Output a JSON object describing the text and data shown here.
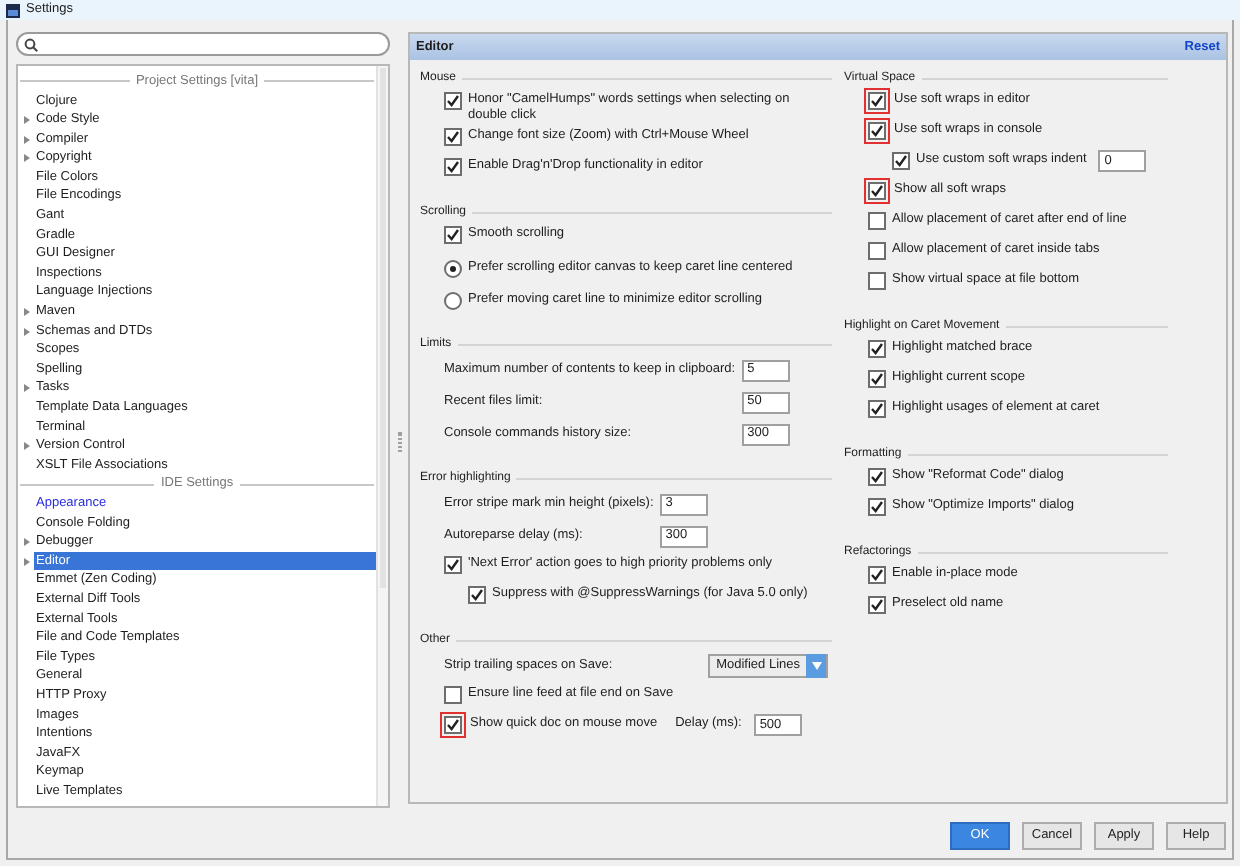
{
  "window": {
    "title": "Settings"
  },
  "tree": [
    {
      "kind": "header",
      "label": "Project Settings [vita]"
    },
    {
      "kind": "item",
      "label": "Clojure",
      "expandable": false,
      "selected": false,
      "modified": false
    },
    {
      "kind": "item",
      "label": "Code Style",
      "expandable": true,
      "selected": false,
      "modified": false
    },
    {
      "kind": "item",
      "label": "Compiler",
      "expandable": true,
      "selected": false,
      "modified": false
    },
    {
      "kind": "item",
      "label": "Copyright",
      "expandable": true,
      "selected": false,
      "modified": false
    },
    {
      "kind": "item",
      "label": "File Colors",
      "expandable": false,
      "selected": false,
      "modified": false
    },
    {
      "kind": "item",
      "label": "File Encodings",
      "expandable": false,
      "selected": false,
      "modified": false
    },
    {
      "kind": "item",
      "label": "Gant",
      "expandable": false,
      "selected": false,
      "modified": false
    },
    {
      "kind": "item",
      "label": "Gradle",
      "expandable": false,
      "selected": false,
      "modified": false
    },
    {
      "kind": "item",
      "label": "GUI Designer",
      "expandable": false,
      "selected": false,
      "modified": false
    },
    {
      "kind": "item",
      "label": "Inspections",
      "expandable": false,
      "selected": false,
      "modified": false
    },
    {
      "kind": "item",
      "label": "Language Injections",
      "expandable": false,
      "selected": false,
      "modified": false
    },
    {
      "kind": "item",
      "label": "Maven",
      "expandable": true,
      "selected": false,
      "modified": false
    },
    {
      "kind": "item",
      "label": "Schemas and DTDs",
      "expandable": true,
      "selected": false,
      "modified": false
    },
    {
      "kind": "item",
      "label": "Scopes",
      "expandable": false,
      "selected": false,
      "modified": false
    },
    {
      "kind": "item",
      "label": "Spelling",
      "expandable": false,
      "selected": false,
      "modified": false
    },
    {
      "kind": "item",
      "label": "Tasks",
      "expandable": true,
      "selected": false,
      "modified": false
    },
    {
      "kind": "item",
      "label": "Template Data Languages",
      "expandable": false,
      "selected": false,
      "modified": false
    },
    {
      "kind": "item",
      "label": "Terminal",
      "expandable": false,
      "selected": false,
      "modified": false
    },
    {
      "kind": "item",
      "label": "Version Control",
      "expandable": true,
      "selected": false,
      "modified": false
    },
    {
      "kind": "item",
      "label": "XSLT File Associations",
      "expandable": false,
      "selected": false,
      "modified": false
    },
    {
      "kind": "header",
      "label": "IDE Settings"
    },
    {
      "kind": "item",
      "label": "Appearance",
      "expandable": false,
      "selected": false,
      "modified": true
    },
    {
      "kind": "item",
      "label": "Console Folding",
      "expandable": false,
      "selected": false,
      "modified": false
    },
    {
      "kind": "item",
      "label": "Debugger",
      "expandable": true,
      "selected": false,
      "modified": false
    },
    {
      "kind": "item",
      "label": "Editor",
      "expandable": true,
      "selected": true,
      "modified": false
    },
    {
      "kind": "item",
      "label": "Emmet (Zen Coding)",
      "expandable": false,
      "selected": false,
      "modified": false
    },
    {
      "kind": "item",
      "label": "External Diff Tools",
      "expandable": false,
      "selected": false,
      "modified": false
    },
    {
      "kind": "item",
      "label": "External Tools",
      "expandable": false,
      "selected": false,
      "modified": false
    },
    {
      "kind": "item",
      "label": "File and Code Templates",
      "expandable": false,
      "selected": false,
      "modified": false
    },
    {
      "kind": "item",
      "label": "File Types",
      "expandable": false,
      "selected": false,
      "modified": false
    },
    {
      "kind": "item",
      "label": "General",
      "expandable": false,
      "selected": false,
      "modified": false
    },
    {
      "kind": "item",
      "label": "HTTP Proxy",
      "expandable": false,
      "selected": false,
      "modified": false
    },
    {
      "kind": "item",
      "label": "Images",
      "expandable": false,
      "selected": false,
      "modified": false
    },
    {
      "kind": "item",
      "label": "Intentions",
      "expandable": false,
      "selected": false,
      "modified": false
    },
    {
      "kind": "item",
      "label": "JavaFX",
      "expandable": false,
      "selected": false,
      "modified": false
    },
    {
      "kind": "item",
      "label": "Keymap",
      "expandable": false,
      "selected": false,
      "modified": false
    },
    {
      "kind": "item",
      "label": "Live Templates",
      "expandable": false,
      "selected": false,
      "modified": false
    }
  ],
  "panel": {
    "title": "Editor",
    "reset": "Reset"
  },
  "columns": [
    [
      {
        "title": "Mouse",
        "items": [
          {
            "kind": "checkbox",
            "label": "Honor \"CamelHumps\" words settings when selecting on double click",
            "checked": true,
            "highlighted": false
          },
          {
            "kind": "checkbox",
            "label": "Change font size (Zoom) with Ctrl+Mouse Wheel",
            "checked": true,
            "highlighted": false
          },
          {
            "kind": "checkbox",
            "label": "Enable Drag'n'Drop functionality in editor",
            "checked": true,
            "highlighted": false
          }
        ]
      },
      {
        "title": "Scrolling",
        "items": [
          {
            "kind": "checkbox",
            "label": "Smooth scrolling",
            "checked": true,
            "highlighted": false
          },
          {
            "kind": "radio",
            "label": "Prefer scrolling editor canvas to keep caret line centered",
            "selected": true
          },
          {
            "kind": "radio",
            "label": "Prefer moving caret line to minimize editor scrolling",
            "selected": false
          }
        ]
      },
      {
        "title": "Limits",
        "items": [
          {
            "kind": "field",
            "label": "Maximum number of contents to keep in clipboard:",
            "value": "5"
          },
          {
            "kind": "field",
            "label": "Recent files limit:",
            "value": "50"
          },
          {
            "kind": "field",
            "label": "Console commands history size:",
            "value": "300"
          }
        ]
      },
      {
        "title": "Error highlighting",
        "items": [
          {
            "kind": "field",
            "label": "Error stripe mark min height (pixels):",
            "value": "3"
          },
          {
            "kind": "field",
            "label": "Autoreparse delay (ms):",
            "value": "300"
          },
          {
            "kind": "checkbox",
            "label": "'Next Error' action goes to high priority problems only",
            "checked": true,
            "highlighted": false,
            "children": [
              {
                "kind": "checkbox",
                "label": "Suppress with @SuppressWarnings (for Java 5.0 only)",
                "checked": true,
                "highlighted": false
              }
            ]
          }
        ]
      },
      {
        "title": "Other",
        "items": [
          {
            "kind": "dropdown",
            "label": "Strip trailing spaces on Save:",
            "value": "Modified Lines"
          },
          {
            "kind": "checkbox",
            "label": "Ensure line feed at file end on Save",
            "checked": false,
            "highlighted": false
          },
          {
            "kind": "checkbox",
            "label": "Show quick doc on mouse move",
            "checked": true,
            "highlighted": true,
            "field_label": "Delay (ms):",
            "value": "500"
          }
        ]
      }
    ],
    [
      {
        "title": "Virtual Space",
        "items": [
          {
            "kind": "checkbox",
            "label": "Use soft wraps in editor",
            "checked": true,
            "highlighted": true
          },
          {
            "kind": "checkbox",
            "label": "Use soft wraps in console",
            "checked": true,
            "highlighted": true,
            "children": [
              {
                "kind": "checkbox",
                "label": "Use custom soft wraps indent",
                "checked": true,
                "highlighted": false,
                "value": "0"
              }
            ]
          },
          {
            "kind": "checkbox",
            "label": "Show all soft wraps",
            "checked": true,
            "highlighted": true
          },
          {
            "kind": "checkbox",
            "label": "Allow placement of caret after end of line",
            "checked": false,
            "highlighted": false
          },
          {
            "kind": "checkbox",
            "label": "Allow placement of caret inside tabs",
            "checked": false,
            "highlighted": false
          },
          {
            "kind": "checkbox",
            "label": "Show virtual space at file bottom",
            "checked": false,
            "highlighted": false
          }
        ]
      },
      {
        "title": "Highlight on Caret Movement",
        "items": [
          {
            "kind": "checkbox",
            "label": "Highlight matched brace",
            "checked": true,
            "highlighted": false
          },
          {
            "kind": "checkbox",
            "label": "Highlight current scope",
            "checked": true,
            "highlighted": false
          },
          {
            "kind": "checkbox",
            "label": "Highlight usages of element at caret",
            "checked": true,
            "highlighted": false
          }
        ]
      },
      {
        "title": "Formatting",
        "items": [
          {
            "kind": "checkbox",
            "label": "Show \"Reformat Code\" dialog",
            "checked": true,
            "highlighted": false
          },
          {
            "kind": "checkbox",
            "label": "Show \"Optimize Imports\" dialog",
            "checked": true,
            "highlighted": false
          }
        ]
      },
      {
        "title": "Refactorings",
        "items": [
          {
            "kind": "checkbox",
            "label": "Enable in-place mode",
            "checked": true,
            "highlighted": false
          },
          {
            "kind": "checkbox",
            "label": "Preselect old name",
            "checked": true,
            "highlighted": false
          }
        ]
      }
    ]
  ],
  "buttons": [
    {
      "label": "OK",
      "kind": "primary"
    },
    {
      "label": "Cancel",
      "kind": "normal"
    },
    {
      "label": "Apply",
      "kind": "normal"
    },
    {
      "label": "Help",
      "kind": "normal"
    }
  ]
}
